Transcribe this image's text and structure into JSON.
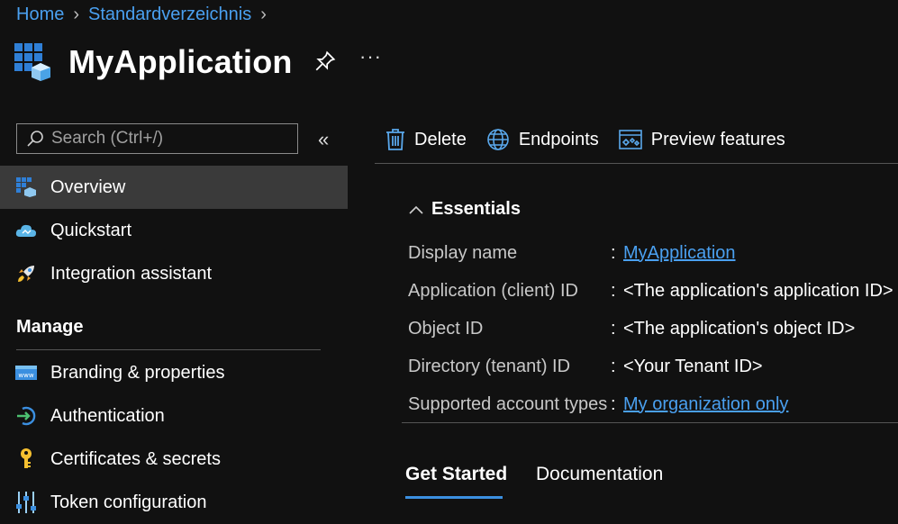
{
  "breadcrumb": {
    "home": "Home",
    "directory": "Standardverzeichnis"
  },
  "header": {
    "title": "MyApplication",
    "more_label": "···"
  },
  "sidebar": {
    "search_placeholder": "Search (Ctrl+/)",
    "collapse_label": "«",
    "items": [
      {
        "label": "Overview",
        "icon": "app-grid-icon",
        "active": true
      },
      {
        "label": "Quickstart",
        "icon": "cloud-icon"
      },
      {
        "label": "Integration assistant",
        "icon": "rocket-icon"
      }
    ],
    "manage_heading": "Manage",
    "manage_items": [
      {
        "label": "Branding & properties",
        "icon": "web-icon"
      },
      {
        "label": "Authentication",
        "icon": "sign-in-icon"
      },
      {
        "label": "Certificates & secrets",
        "icon": "key-icon"
      },
      {
        "label": "Token configuration",
        "icon": "sliders-icon"
      }
    ]
  },
  "toolbar": {
    "delete_label": "Delete",
    "endpoints_label": "Endpoints",
    "preview_label": "Preview features"
  },
  "essentials": {
    "heading": "Essentials",
    "rows": [
      {
        "label": "Display name",
        "value": "MyApplication",
        "link": true
      },
      {
        "label": "Application (client) ID",
        "value": "<The application's application ID>",
        "link": false
      },
      {
        "label": "Object ID",
        "value": "<The application's object ID>",
        "link": false
      },
      {
        "label": "Directory (tenant) ID",
        "value": "<Your Tenant ID>",
        "link": false
      },
      {
        "label": "Supported account types",
        "value": "My organization only",
        "link": true
      }
    ]
  },
  "tabs": [
    {
      "label": "Get Started",
      "active": true
    },
    {
      "label": "Documentation",
      "active": false
    }
  ],
  "colors": {
    "accent": "#4aa0f0",
    "background": "#111111",
    "active_nav": "#3a3a3a"
  }
}
